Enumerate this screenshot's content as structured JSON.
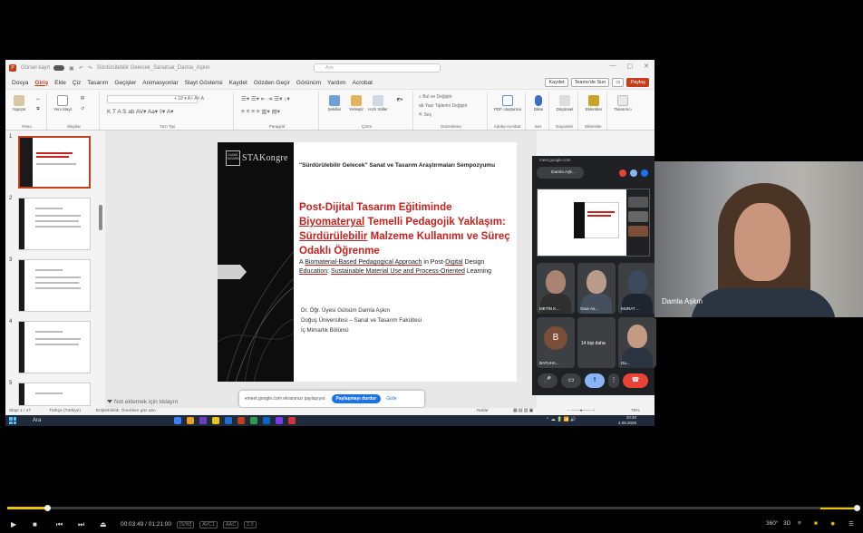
{
  "app": {
    "title_filename": "Görsel kayıt",
    "title_doc": "Sürdürülebilir Gelecek_Sanatsal_Damla_Aşkın",
    "search_placeholder": "Ara"
  },
  "menu": [
    "Dosya",
    "Giriş",
    "Ekle",
    "Çiz",
    "Tasarım",
    "Geçişler",
    "Animasyonlar",
    "Slayt Gösterisi",
    "Kaydet",
    "Gözden Geçir",
    "Görünüm",
    "Yardım",
    "Acrobat"
  ],
  "menu_active": "Giriş",
  "menu_right": {
    "save": "Kaydet",
    "teams": "Teams'de Sun",
    "share": "Paylaş"
  },
  "ribbon": {
    "groups": [
      "Pano",
      "Slaytlar",
      "Yazı Tipi",
      "Paragraf",
      "Çizim",
      "Düzenleme",
      "Adobe Acrobat",
      "Ses",
      "Dayanıklı",
      "Eklentiler"
    ],
    "paste": "Yapıştır",
    "new_slide": "Yeni Slayt",
    "shapes": "Şekiller",
    "arrange": "Yerleştir",
    "quick_styles": "Hızlı Stiller",
    "find": "Bul ve Değiştir",
    "replace_font": "Yazı Tiplerini Değiştir",
    "select": "Seç",
    "pdf": "PDF oluşturma",
    "dictate": "Dikte",
    "designer": "Düşünsel",
    "addins": "Eklentiler",
    "designer2": "Tasarımcı"
  },
  "thumbnails": [
    "1",
    "2",
    "3",
    "4",
    "5"
  ],
  "slide": {
    "logo_seal": "SANAT TASARIM",
    "logo_text": "STAKongre",
    "conference": "\"Sürdürülebilir Gelecek\" Sanat ve Tasarım Araştırmaları Sempozyumu",
    "title_1": "Post-Dijital Tasarım Eğitiminde ",
    "title_bio": "Biyomateryal",
    "title_2": "Temelli Pedagojik Yaklaşım: ",
    "title_sust": "Sürdürülebilir",
    "title_3": "Malzeme Kullanımı ve Süreç Odaklı Öğrenme",
    "subtitle_1": "A ",
    "subtitle_bio": "Biomaterial-Based Pedagogical Approach",
    "subtitle_2": " in Post-",
    "subtitle_dig": "Digital",
    "subtitle_3": " Design ",
    "subtitle_edu": "Education",
    "subtitle_4": ": ",
    "subtitle_sust": "Sustainable Material Use and Process-Oriented",
    "subtitle_5": " Learning",
    "authors": [
      "Dr. Öğr. Üyesi Gülsüm Damla Aşkın",
      "Doğuş Üniversitesi – Sanat ve Tasarım Fakültesi",
      "İç Mimarlık Bölümü"
    ]
  },
  "notes_placeholder": "Not eklemek için tıklayın",
  "share_banner": {
    "text": "meet.google.com ekranınızı paylaşıyor.",
    "stop": "Paylaşmayı durdur",
    "hide": "Gizle"
  },
  "statusbar": {
    "slide": "Slayt 1 / 47",
    "lang": "Türkçe (Türkiye)",
    "accessibility": "Erişilebilirlik: Önerilere göz atın",
    "notes": "Notlar",
    "zoom": "76%"
  },
  "taskbar": {
    "search": "Ara",
    "time": "10:40",
    "date": "4.05.2026"
  },
  "meet": {
    "url": "meet.google.com",
    "user": "Damla Aşk...",
    "participants": [
      "METİN K...",
      "Onur As...",
      "MURAT ...",
      "BATUHA...",
      "Da..."
    ],
    "avatar_letter": "B",
    "more": "14 kişi daha"
  },
  "presenter_name": "Damla Aşkın",
  "player": {
    "time": "00:03:49 / 01:21:00",
    "tags": [
      "[S/W]",
      "AVC1",
      "AAC",
      "2.0"
    ],
    "right": [
      "360°",
      "3D"
    ],
    "progress": 0.047,
    "volume": 1.0
  }
}
